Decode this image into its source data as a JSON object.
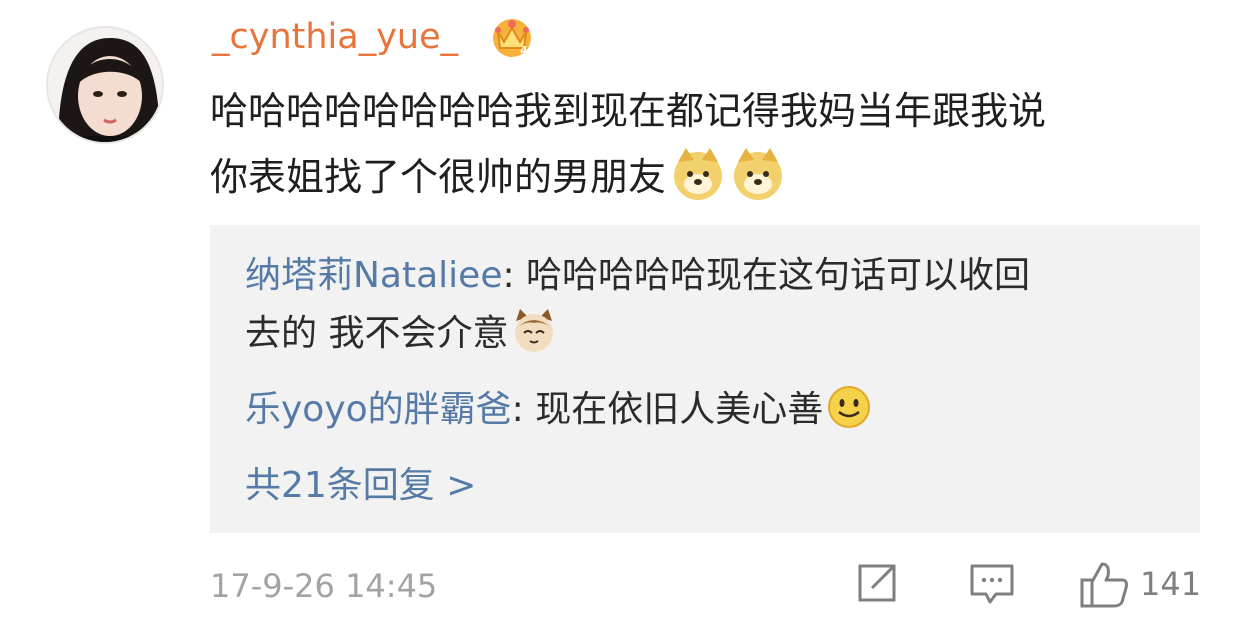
{
  "comment": {
    "username": "_cynthia_yue_",
    "badge_icon": "crown-icon",
    "text_line1": "哈哈哈哈哈哈哈哈我到现在都记得我妈当年跟我说",
    "text_line2": "你表姐找了个很帅的男朋友",
    "emojis": [
      "doge-emoji",
      "doge-emoji"
    ],
    "timestamp": "17-9-26 14:45",
    "like_count": "141"
  },
  "replies": [
    {
      "name": "纳塔莉Nataliee",
      "separator": ": ",
      "text_line1": "哈哈哈哈哈现在这句话可以收回",
      "text_line2": "去的 我不会介意",
      "emoji": "cat-emoji"
    },
    {
      "name": "乐yoyo的胖霸爸",
      "separator": ": ",
      "text_line1": "现在依旧人美心善",
      "emoji": "smile-emoji"
    }
  ],
  "all_replies_label": "共21条回复 >",
  "colors": {
    "username": "#e8743b",
    "reply_name": "#567aa6",
    "reply_bg": "#f2f2f2",
    "timestamp": "#a3a3a3"
  }
}
